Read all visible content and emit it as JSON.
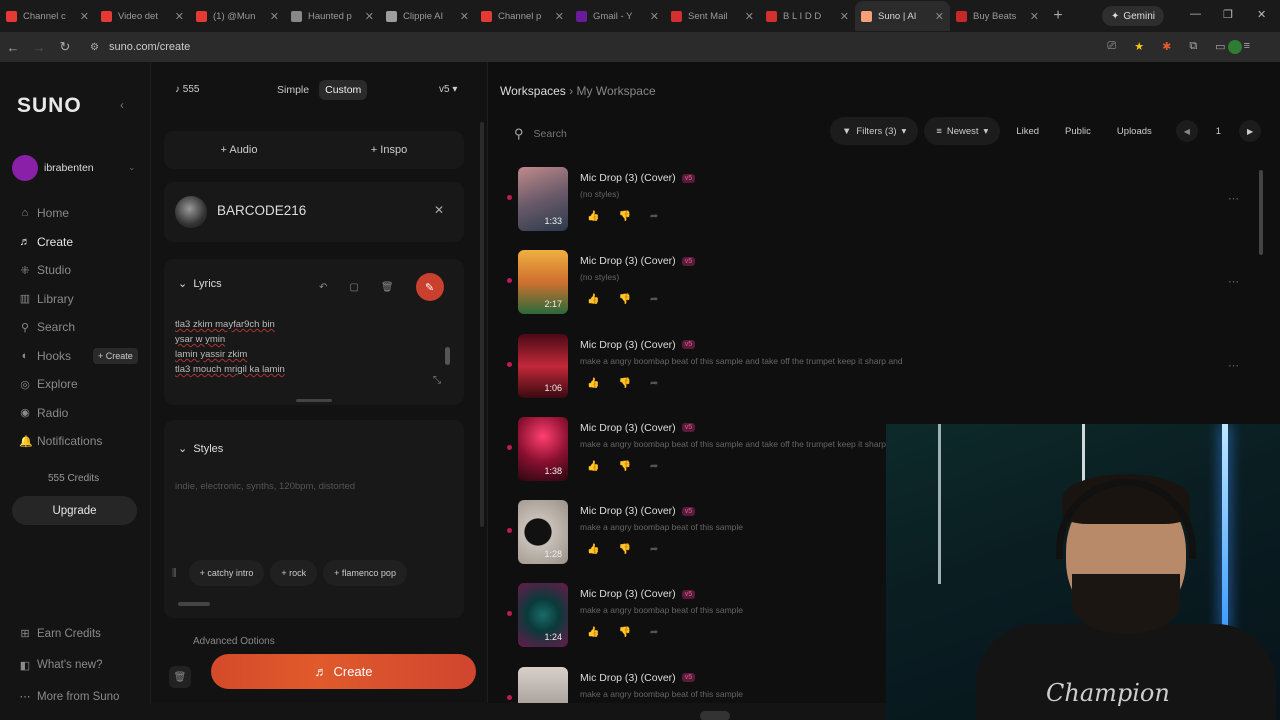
{
  "browser": {
    "tabs": [
      {
        "label": "Channel c",
        "color": "#e53935"
      },
      {
        "label": "Video det",
        "color": "#e53935"
      },
      {
        "label": "(1) @Mun",
        "color": "#e53935"
      },
      {
        "label": "Haunted p",
        "color": "#888888"
      },
      {
        "label": "Clippie AI",
        "color": "#9e9e9e"
      },
      {
        "label": "Channel p",
        "color": "#e53935"
      },
      {
        "label": "Gmail - Y",
        "color": "#6a1b9a"
      },
      {
        "label": "Sent Mail",
        "color": "#d32f2f"
      },
      {
        "label": "B L I D D",
        "color": "#d32f2f"
      },
      {
        "label": "Suno | AI",
        "color": "#f5a07a"
      },
      {
        "label": "Buy Beats",
        "color": "#c62828"
      }
    ],
    "new_tab": "+",
    "gemini": "Gemini",
    "url": "suno.com/create",
    "minimize": "—",
    "restore": "❐",
    "close": "✕"
  },
  "sidebar": {
    "logo": "SUNO",
    "username": "ibrabenten",
    "nav": [
      {
        "label": "Home",
        "icon": "⌂"
      },
      {
        "label": "Create",
        "icon": "♬"
      },
      {
        "label": "Studio",
        "icon": "⁜"
      },
      {
        "label": "Library",
        "icon": "▥"
      },
      {
        "label": "Search",
        "icon": "⚲"
      },
      {
        "label": "Hooks",
        "icon": "◐"
      },
      {
        "label": "Explore",
        "icon": "◎"
      },
      {
        "label": "Radio",
        "icon": "◉"
      },
      {
        "label": "Notifications",
        "icon": "🔔"
      }
    ],
    "hooks_create": "+ Create",
    "credits": "555 Credits",
    "upgrade": "Upgrade",
    "bottom": [
      {
        "label": "Earn Credits",
        "icon": "⊞"
      },
      {
        "label": "What's new?",
        "icon": "◧"
      },
      {
        "label": "More from Suno",
        "icon": "⋯"
      }
    ]
  },
  "create": {
    "credits": "555",
    "mode_simple": "Simple",
    "mode_custom": "Custom",
    "version": "v5",
    "audio": "+ Audio",
    "inspo": "+ Inspo",
    "persona": "BARCODE216",
    "lyrics_label": "Lyrics",
    "lyrics": [
      "tla3 zkim mayfar9ch bin",
      "ysar w ymin",
      "lamin yassir zkim",
      "tla3 mouch mrigil ka lamin"
    ],
    "styles_label": "Styles",
    "styles_placeholder": "indie, electronic, synths, 120bpm, distorted",
    "chips": [
      "+ catchy intro",
      "+ rock",
      "+ flamenco pop"
    ],
    "advanced": "Advanced Options",
    "create_button": "Create"
  },
  "main": {
    "breadcrumb_root": "Workspaces",
    "breadcrumb_current": "My Workspace",
    "search_placeholder": "Search",
    "filters": "Filters (3)",
    "sort": "Newest",
    "liked": "Liked",
    "public": "Public",
    "uploads": "Uploads",
    "page": "1",
    "songs": [
      {
        "title": "Mic Drop (3) (Cover)",
        "tag": "v5",
        "desc": "(no styles)",
        "dur": "1:33",
        "bg": "linear-gradient(160deg,#c08a8a,#6a5a6a 50%,#2a3a4a)"
      },
      {
        "title": "Mic Drop (3) (Cover)",
        "tag": "v5",
        "desc": "(no styles)",
        "dur": "2:17",
        "bg": "linear-gradient(180deg,#f0b040,#d07030 50%,#2a6a3a)"
      },
      {
        "title": "Mic Drop (3) (Cover)",
        "tag": "v5",
        "desc": "make a angry boombap beat of this sample and take off the trumpet keep it sharp and",
        "dur": "1:06",
        "bg": "linear-gradient(180deg,#4a0a14,#c2283a 50%,#3a0a10)"
      },
      {
        "title": "Mic Drop (3) (Cover)",
        "tag": "v5",
        "desc": "make a angry boombap beat of this sample and take off the trumpet keep it sharp a",
        "dur": "1:38",
        "bg": "radial-gradient(circle at 50% 30%,#ff4070,#8a1030 50%,#2a0810)"
      },
      {
        "title": "Mic Drop (3) (Cover)",
        "tag": "v5",
        "desc": "make a angry boombap beat of this sample",
        "dur": "1:28",
        "bg": "radial-gradient(circle at 40% 50%,#111 30%,#c8c0b8 32%,#9a9088)"
      },
      {
        "title": "Mic Drop (3) (Cover)",
        "tag": "v5",
        "desc": "make a angry boombap beat of this sample",
        "dur": "1:24",
        "bg": "radial-gradient(circle at 50% 50%,#1a6a6a,#0a3a3a 40%,#6a1a4a)"
      },
      {
        "title": "Mic Drop (3) (Cover)",
        "tag": "v5",
        "desc": "make a angry boombap beat of this sample",
        "dur": "",
        "bg": "linear-gradient(180deg,#d8d0c8,#8a8280)"
      }
    ]
  },
  "webcam": {
    "shirt_text": "Champion"
  }
}
